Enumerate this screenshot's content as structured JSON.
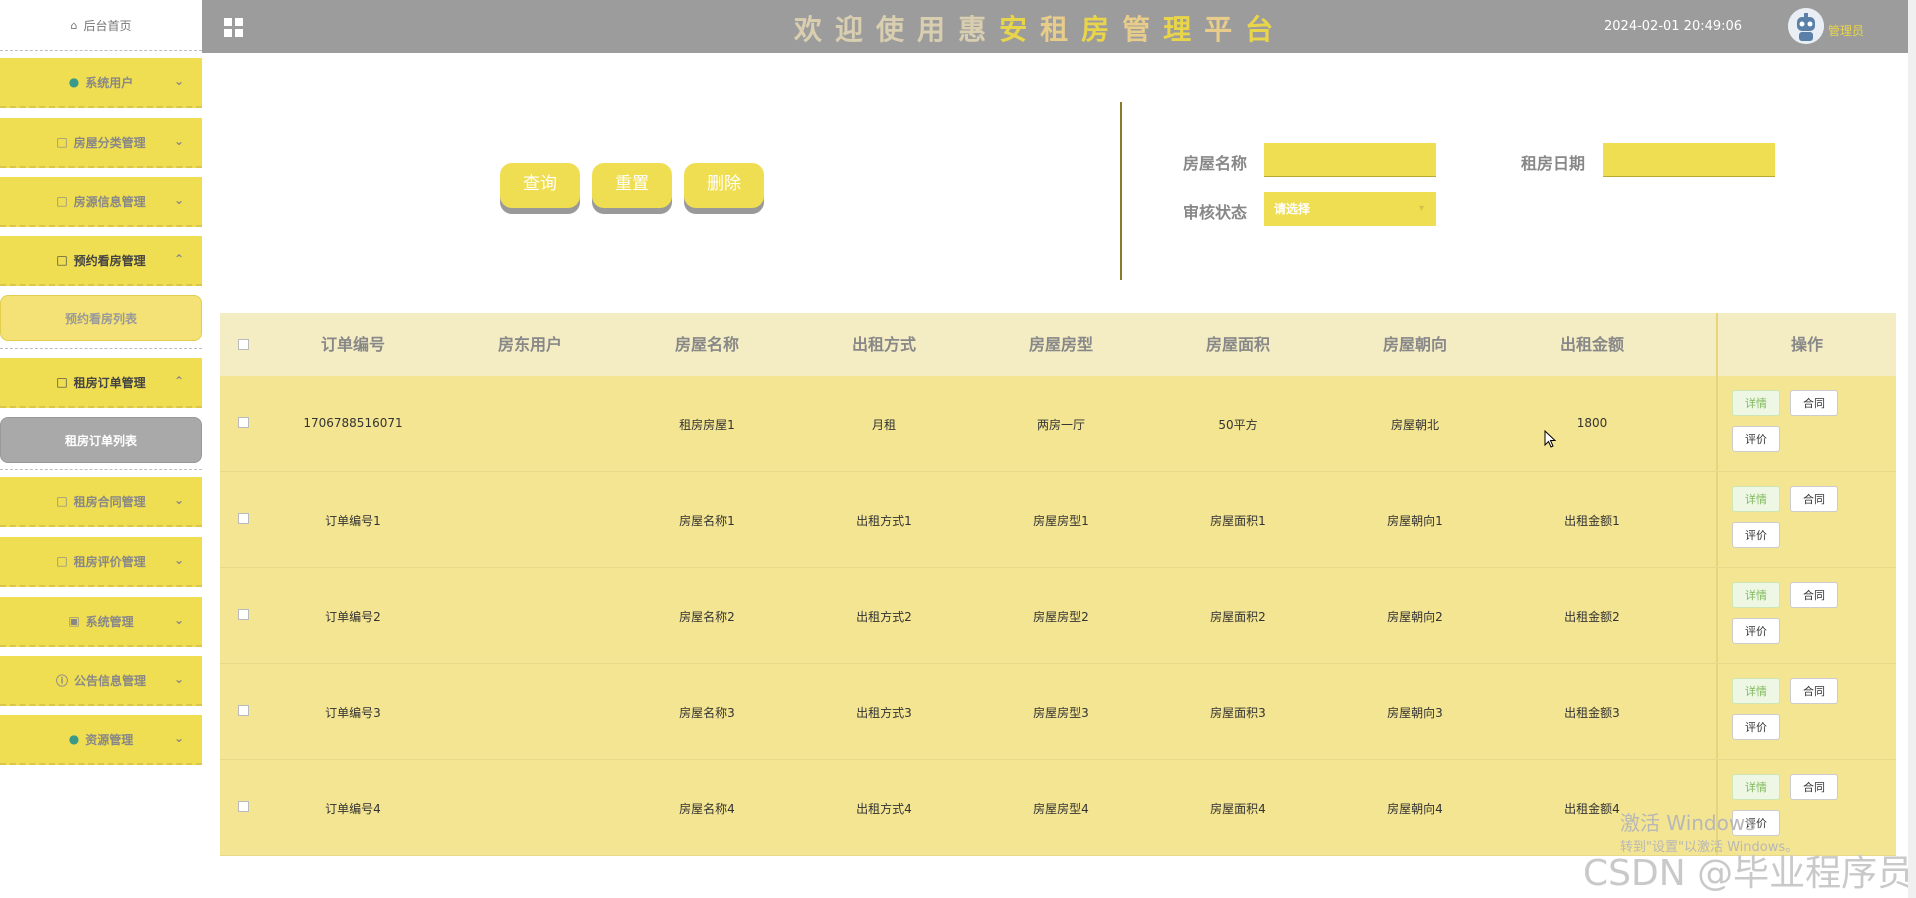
{
  "topbar": {
    "title": "欢迎使用惠安租房管理平台",
    "datetime": "2024-02-01 20:49:06",
    "role": "管理员",
    "title_color_a": "#d9cfb0",
    "title_color_b": "#e9d54a"
  },
  "sidebar": {
    "home": "后台首页",
    "items": [
      {
        "label": "系统用户",
        "icon": "user-icon"
      },
      {
        "label": "房屋分类管理",
        "icon": "edit-icon"
      },
      {
        "label": "房源信息管理",
        "icon": "edit-icon"
      },
      {
        "label": "预约看房管理",
        "icon": "edit-icon",
        "sub": "预约看房列表"
      },
      {
        "label": "租房订单管理",
        "icon": "edit-icon",
        "sub": "租房订单列表"
      },
      {
        "label": "租房合同管理",
        "icon": "edit-icon"
      },
      {
        "label": "租房评价管理",
        "icon": "edit-icon"
      },
      {
        "label": "系统管理",
        "icon": "picture-icon"
      },
      {
        "label": "公告信息管理",
        "icon": "info-icon"
      },
      {
        "label": "资源管理",
        "icon": "location-icon"
      }
    ]
  },
  "search": {
    "query_btn": "查询",
    "reset_btn": "重置",
    "delete_btn": "删除",
    "house_name_label": "房屋名称",
    "rent_date_label": "租房日期",
    "audit_label": "审核状态",
    "audit_placeholder": "请选择"
  },
  "table": {
    "headers": [
      "订单编号",
      "房东用户",
      "房屋名称",
      "出租方式",
      "房屋房型",
      "房屋面积",
      "房屋朝向",
      "出租金额",
      "操作"
    ],
    "rows": [
      [
        "1706788516071",
        "",
        "租房房屋1",
        "月租",
        "两房一厅",
        "50平方",
        "房屋朝北",
        "1800"
      ],
      [
        "订单编号1",
        "",
        "房屋名称1",
        "出租方式1",
        "房屋房型1",
        "房屋面积1",
        "房屋朝向1",
        "出租金额1"
      ],
      [
        "订单编号2",
        "",
        "房屋名称2",
        "出租方式2",
        "房屋房型2",
        "房屋面积2",
        "房屋朝向2",
        "出租金额2"
      ],
      [
        "订单编号3",
        "",
        "房屋名称3",
        "出租方式3",
        "房屋房型3",
        "房屋面积3",
        "房屋朝向3",
        "出租金额3"
      ],
      [
        "订单编号4",
        "",
        "房屋名称4",
        "出租方式4",
        "房屋房型4",
        "房屋面积4",
        "房屋朝向4",
        "出租金额4"
      ]
    ],
    "op_detail": "详情",
    "op_contract": "合同",
    "op_review": "评价"
  },
  "overlay": {
    "activate_line1": "激活 Windows",
    "activate_line2": "转到\"设置\"以激活 Windows。",
    "csdn": "CSDN @毕业程序员"
  },
  "colors": {
    "accent": "#f0de52",
    "topbar": "#9c9c9c",
    "row": "#f4e592",
    "header": "#f4edc4"
  }
}
